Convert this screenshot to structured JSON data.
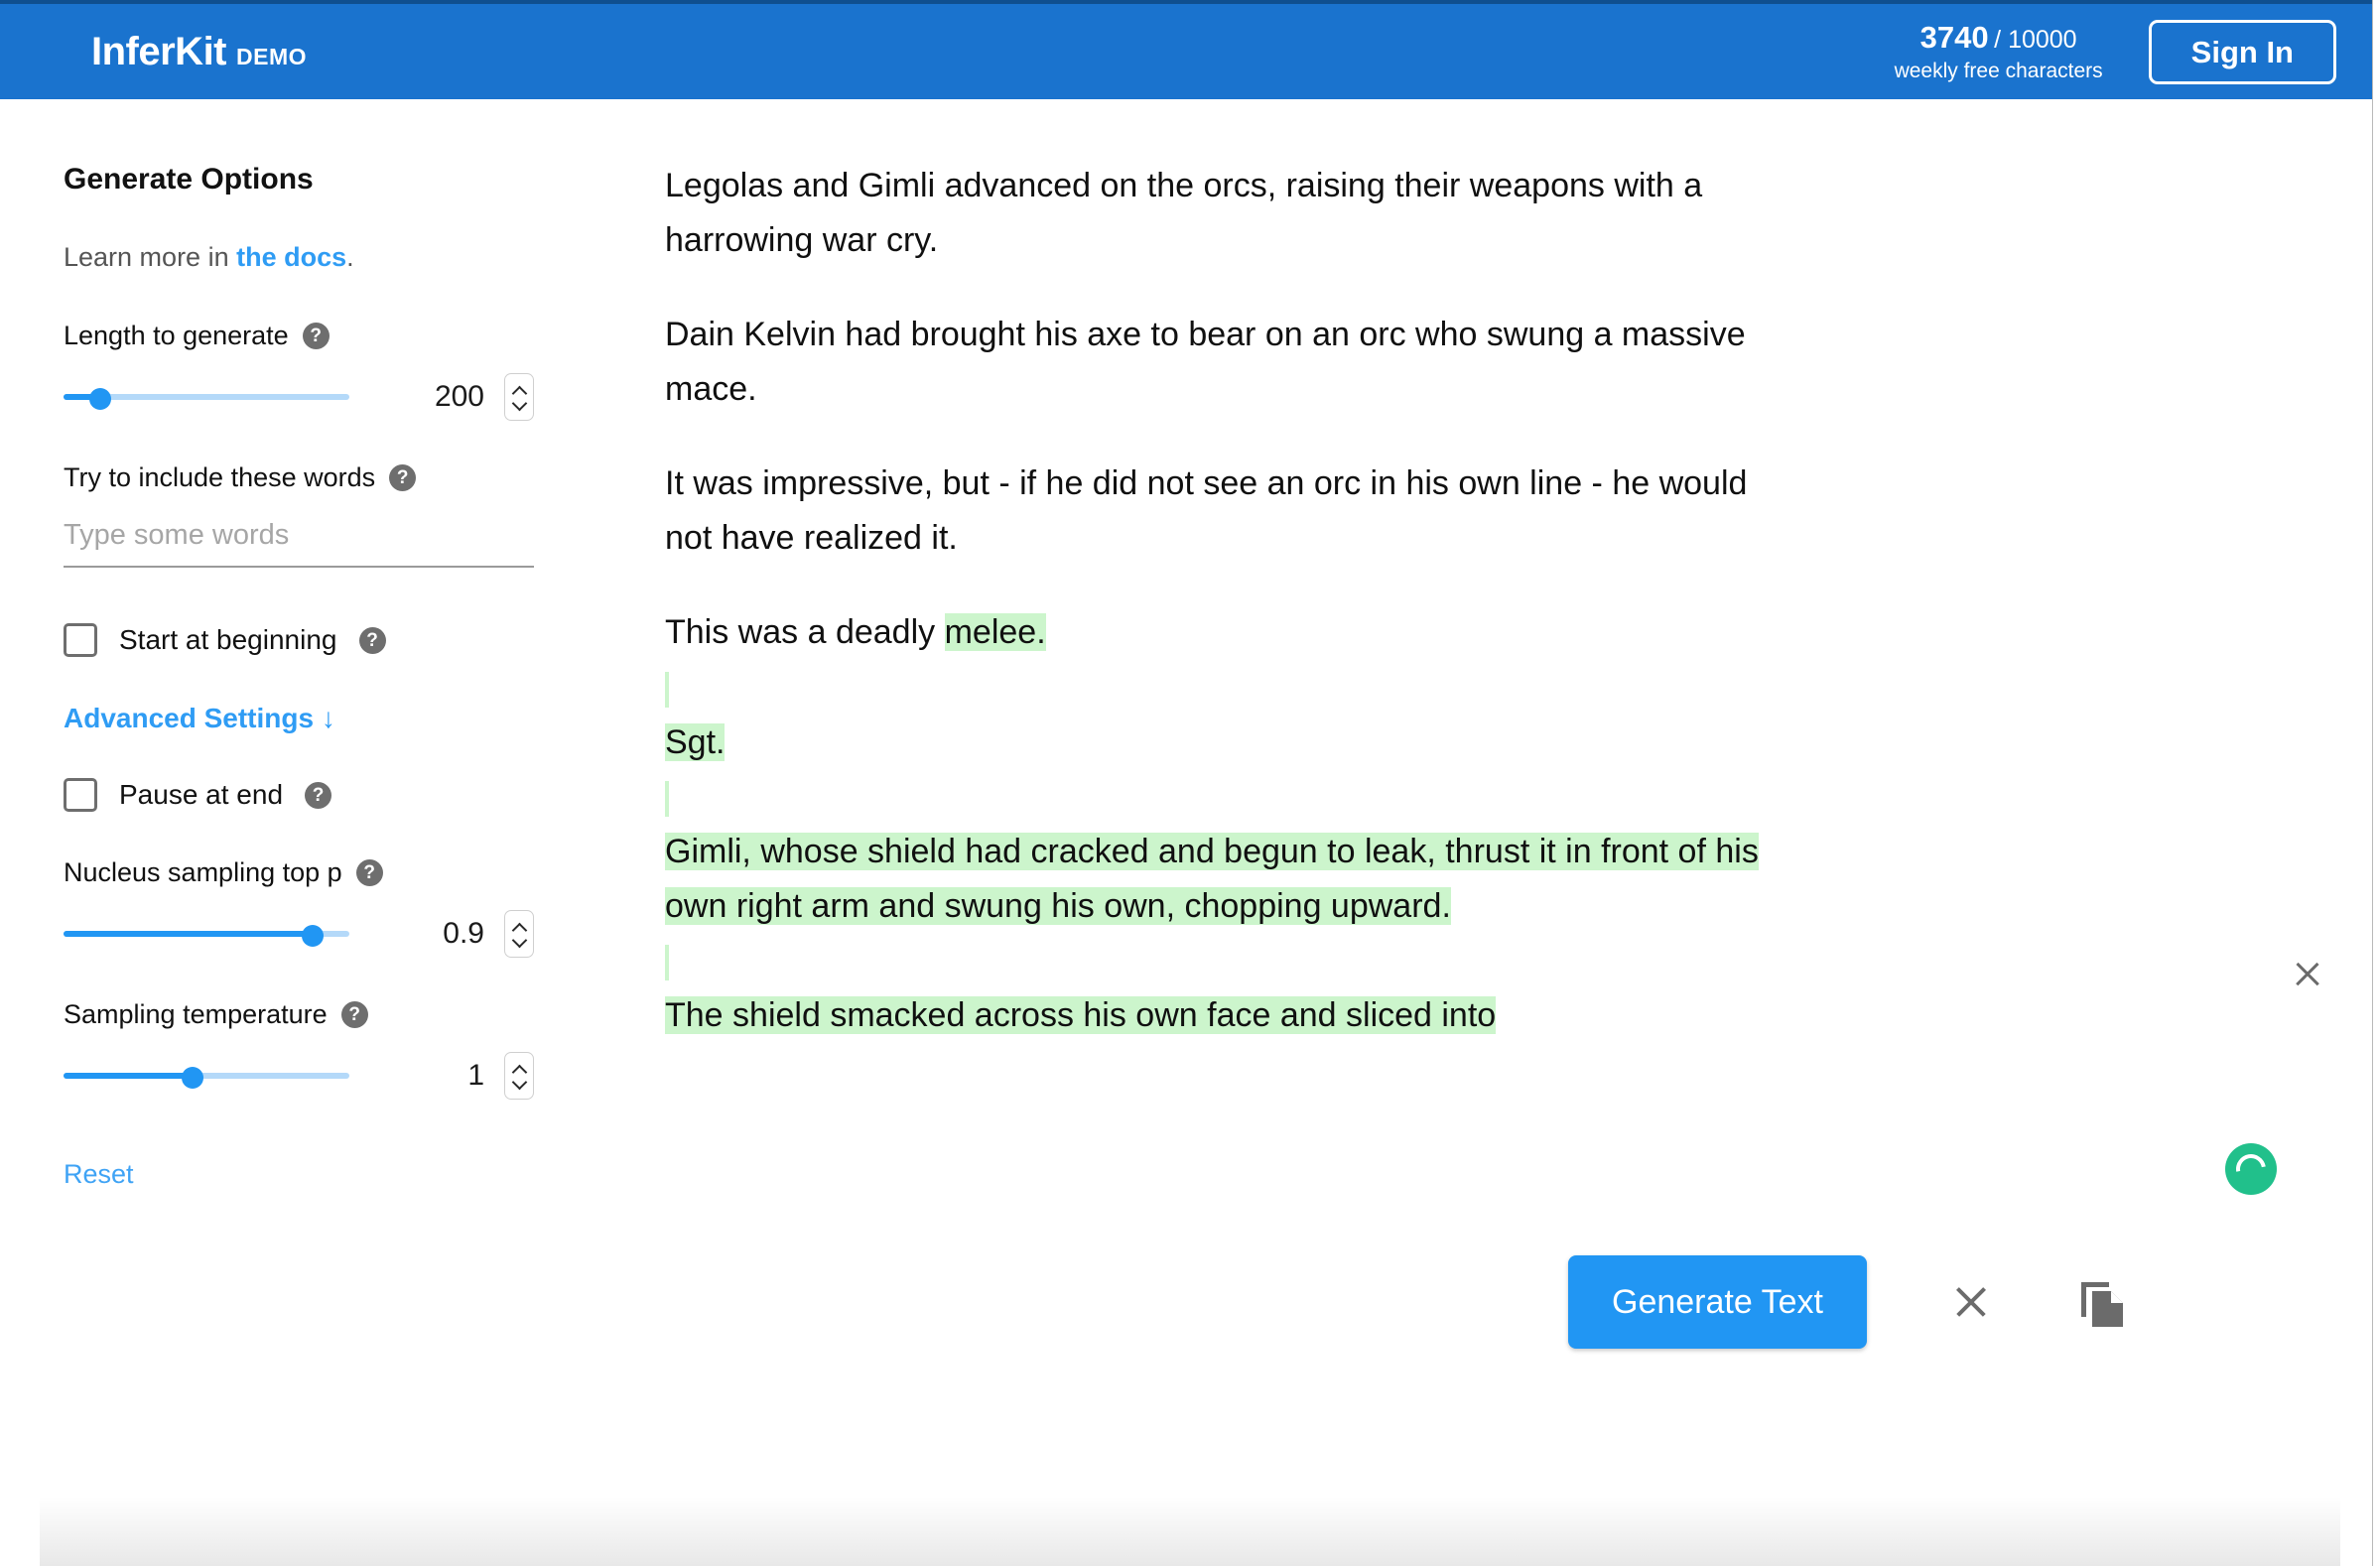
{
  "header": {
    "brand_name": "InferKit",
    "brand_suffix": "DEMO",
    "quota_used": "3740",
    "quota_total": "/ 10000",
    "quota_label": "weekly free characters",
    "sign_in_label": "Sign In"
  },
  "sidebar": {
    "title": "Generate Options",
    "learn_more_prefix": "Learn more in ",
    "learn_more_link": "the docs",
    "learn_more_suffix": ".",
    "length": {
      "label": "Length to generate",
      "help": "?",
      "value": "200",
      "slider_percent": 13
    },
    "include_words": {
      "label": "Try to include these words",
      "help": "?",
      "placeholder": "Type some words",
      "value": ""
    },
    "start_at_beginning": {
      "label": "Start at beginning",
      "help": "?",
      "checked": false
    },
    "advanced_settings_label": "Advanced Settings ↓",
    "pause_at_end": {
      "label": "Pause at end",
      "help": "?",
      "checked": false
    },
    "top_p": {
      "label": "Nucleus sampling top p",
      "help": "?",
      "value": "0.9",
      "slider_percent": 87
    },
    "temperature": {
      "label": "Sampling temperature",
      "help": "?",
      "value": "1",
      "slider_percent": 45
    },
    "reset_label": "Reset"
  },
  "editor": {
    "paragraphs": [
      "Legolas and Gimli advanced on the orcs, raising their weapons with a harrowing war cry.",
      "Dain Kelvin had brought his axe to bear on an orc who swung a massive mace.",
      "It was impressive, but - if he did not see an orc in his own line - he would not have realized it."
    ],
    "p4_plain": "This was a deadly ",
    "p4_highlight": "melee.",
    "p5_highlight": "Sgt.",
    "p6_highlight": "Gimli, whose shield had cracked and begun to leak, thrust it in front of his own right arm and swung his own, chopping upward.",
    "p7_highlight": "The shield smacked across his own face and sliced into",
    "highlight_color": "#ccf5cc"
  },
  "actions": {
    "generate_label": "Generate Text",
    "clear_icon": "close-icon",
    "copy_icon": "copy-icon",
    "delete_icon": "close-icon",
    "spinner_icon": "loading-spinner-icon",
    "spinner_color": "#21c08b"
  },
  "colors": {
    "brand_blue": "#1a73ce",
    "accent_blue": "#2196f3",
    "link_blue": "#2f9cf4"
  }
}
